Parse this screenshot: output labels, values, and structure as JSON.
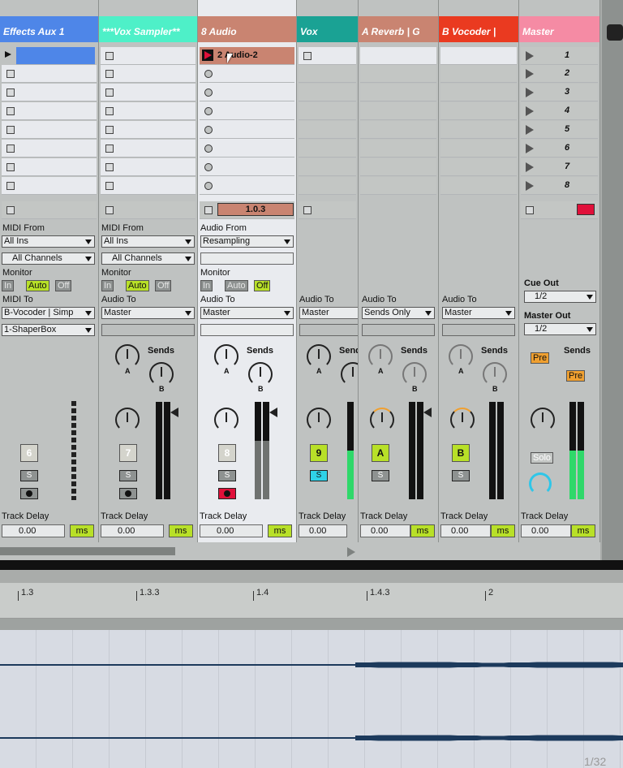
{
  "tracks": [
    {
      "name": "Effects Aux 1",
      "color": "#4e86e8",
      "io_from_label": "MIDI From",
      "io_from_value": "All Ins",
      "io_channel": "All Channels",
      "io_to_value": "B-Vocoder | Simp",
      "io_to_sub": "1-ShaperBox",
      "track_number": "6"
    },
    {
      "name": "***Vox Sampler**",
      "color": "#4ef0c8",
      "io_from_label": "MIDI From",
      "io_from_value": "All Ins",
      "io_channel": "All Channels",
      "io_to_value": "Master",
      "track_number": "7"
    },
    {
      "name": "8 Audio",
      "color": "#c98471",
      "io_from_label": "Audio From",
      "io_from_value": "Resampling",
      "io_to_value": "Master",
      "clip_name": "2 Audio-2",
      "clip_position": "1.0.3",
      "track_number": "8"
    },
    {
      "name": "Vox",
      "color": "#1aa294",
      "io_to_value": "Master",
      "track_number": "9"
    },
    {
      "name": "A Reverb | G",
      "color": "#c98471",
      "io_to_value": "Sends Only",
      "track_number": "A"
    },
    {
      "name": "B Vocoder |",
      "color": "#ea3a20",
      "io_to_value": "Master",
      "track_number": "B"
    },
    {
      "name": "Master",
      "color": "#f58ba4"
    }
  ],
  "labels": {
    "monitor": "Monitor",
    "audio_to": "Audio To",
    "midi_to": "MIDI To",
    "sends": "Sends",
    "track_delay": "Track Delay",
    "delay_value": "0.00",
    "delay_unit": "ms",
    "monitor_in": "In",
    "monitor_auto": "Auto",
    "monitor_off": "Off",
    "send_a": "A",
    "send_b": "B",
    "solo_s": "S",
    "solo_label": "Solo",
    "pre": "Pre"
  },
  "master": {
    "scenes": [
      "1",
      "2",
      "3",
      "4",
      "5",
      "6",
      "7",
      "8"
    ],
    "cue_out_label": "Cue Out",
    "cue_out_value": "1/2",
    "master_out_label": "Master Out",
    "master_out_value": "1/2"
  },
  "timeline": {
    "ruler": [
      "1.3",
      "1.3.3",
      "1.4",
      "1.4.3",
      "2"
    ],
    "page_indicator": "1/32"
  },
  "colors": {
    "active_green": "#b8e028",
    "record_red": "#e0103a",
    "waveform": "#1c3a5c"
  }
}
